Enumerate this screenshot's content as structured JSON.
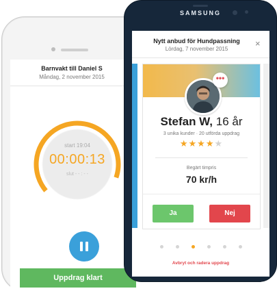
{
  "left_phone": {
    "title": "Barnvakt till Daniel S",
    "subtitle": "Måndag, 2 november 2015",
    "timer": {
      "start_label": "start 19:04",
      "elapsed": "00:00:13",
      "end_label": "slut - - : - -",
      "accent": "#f5a623"
    },
    "pause_icon": "pause-icon",
    "primary_button": "Uppdrag klart",
    "button_color": "#5fb85f"
  },
  "right_phone": {
    "brand": "SAMSUNG",
    "title": "Nytt anbud för Hundpassning",
    "subtitle": "Lördag, 7 november 2015",
    "close_icon": "×",
    "card": {
      "name": "Stefan W,",
      "age": "16 år",
      "stats": "3 unika kunder · 20 utförda uppdrag",
      "rating": 4,
      "rating_max": 5,
      "chat_icon": "•••",
      "price_label": "Begärt timpris",
      "price": "70 kr/h",
      "accept_label": "Ja",
      "decline_label": "Nej"
    },
    "pager": {
      "count": 6,
      "active": 2
    },
    "cancel_link": "Avbryt och radera uppdrag",
    "colors": {
      "accept": "#6cc66c",
      "decline": "#e2464c",
      "accent": "#f5a623",
      "peek": "#3aa0da"
    }
  }
}
